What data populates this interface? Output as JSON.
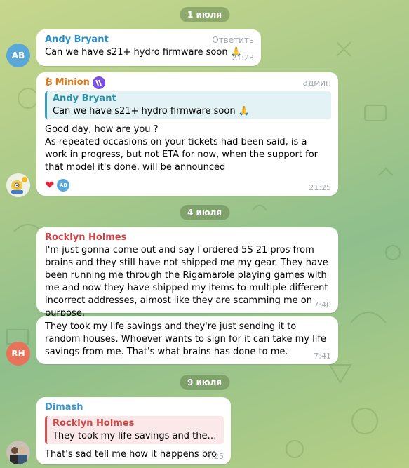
{
  "dates": {
    "d1": "1 июля",
    "d2": "4 июля",
    "d3": "9 июля"
  },
  "messages": {
    "m1": {
      "avatar_initials": "AB",
      "sender": "Andy Bryant",
      "action": "Ответить",
      "text": "Can we have s21+ hydro firmware soon 🙏",
      "time": "21:23"
    },
    "m2": {
      "btc_icon": "₿",
      "sender": "Minion",
      "role": "админ",
      "reply_sender": "Andy Bryant",
      "reply_text": "Can we have s21+ hydro firmware soon 🙏",
      "line1": "Good day, how are you ?",
      "line2": "As repeated occasions on your tickets had been said, is a work in progress, but not ETA for now, when the support for that model it's done, will be announced",
      "reaction_heart": "❤",
      "reaction_avatar": "AB",
      "time": "21:25"
    },
    "m3": {
      "sender": "Rocklyn Holmes",
      "text": "I'm just gonna come out and say I ordered 5S 21 pros from brains and they still have not shipped me my gear. They have been running me through the Rigamarole playing games with me and now they have shipped my items to multiple different incorrect addresses, almost like they are scamming me on purpose.",
      "time": "7:40"
    },
    "m4": {
      "avatar_initials": "RH",
      "text": "They took my life savings and they're just sending it to random houses. Whoever wants to sign for it can take my life savings from me. That's what brains has done to me.",
      "time": "7:41"
    },
    "m5": {
      "sender": "Dimash",
      "reply_sender": "Rocklyn Holmes",
      "reply_text": "They took my life savings and they're j...",
      "text": "That's sad tell me how it happens bro",
      "time": "4:25"
    }
  },
  "colors": {
    "andy": "#2a8fc6",
    "minion": "#e07a16",
    "rocklyn": "#cf4545",
    "dimash": "#3a95c9",
    "ab_avatar": "#5aa8d8",
    "rh_avatar": "#e8735a"
  }
}
